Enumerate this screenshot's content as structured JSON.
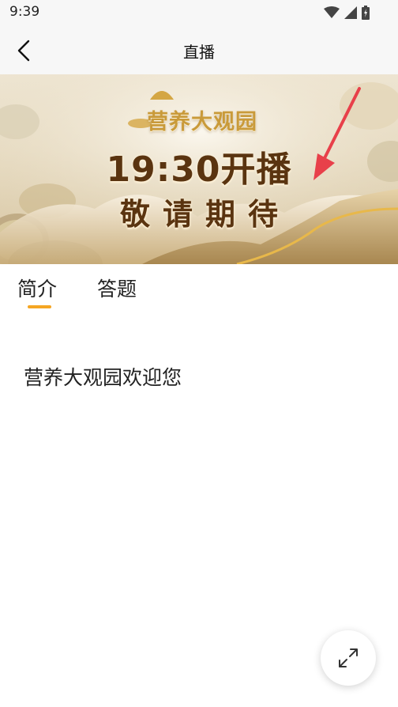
{
  "status_bar": {
    "time": "9:39"
  },
  "nav": {
    "title": "直播"
  },
  "banner": {
    "brand": "营养大观园",
    "line1": "19:30开播",
    "line2": "敬请期待"
  },
  "tabs": [
    {
      "label": "简介",
      "active": true
    },
    {
      "label": "答题",
      "active": false
    }
  ],
  "content": {
    "intro_text": "营养大观园欢迎您"
  },
  "colors": {
    "accent": "#f5a623",
    "banner_text": "#5a3410",
    "arrow": "#e8404a"
  }
}
